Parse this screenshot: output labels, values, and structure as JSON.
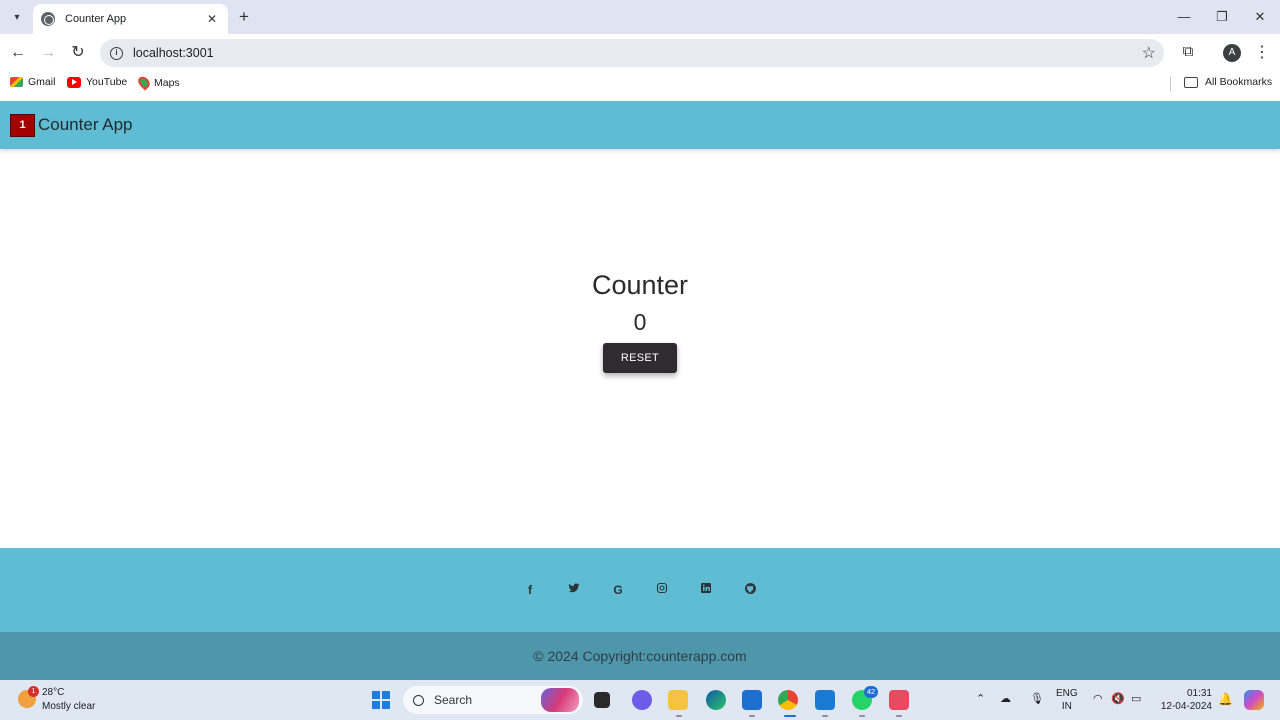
{
  "browser": {
    "tab_title": "Counter App",
    "url": "localhost:3001",
    "profile_initial": "A",
    "bookmarks": [
      {
        "label": "Gmail",
        "icon": "gmail-icon"
      },
      {
        "label": "YouTube",
        "icon": "youtube-icon"
      },
      {
        "label": "Maps",
        "icon": "maps-icon"
      }
    ],
    "all_bookmarks_label": "All Bookmarks"
  },
  "app": {
    "badge": "1",
    "title": "Counter App",
    "header_color": "#5fbcd3",
    "badge_color": "#a30000"
  },
  "counter": {
    "heading": "Counter",
    "value": "0",
    "reset_label": "RESET"
  },
  "footer": {
    "social_icons": [
      "facebook-icon",
      "twitter-icon",
      "google-icon",
      "instagram-icon",
      "linkedin-icon",
      "github-icon"
    ],
    "copyright": "© 2024 Copyright:counterapp.com"
  },
  "taskbar": {
    "weather_temp": "28°C",
    "weather_desc": "Mostly clear",
    "weather_badge": "1",
    "search_label": "Search",
    "whatsapp_badge": "42",
    "lang_line1": "ENG",
    "lang_line2": "IN",
    "time": "01:31",
    "date": "12-04-2024"
  }
}
